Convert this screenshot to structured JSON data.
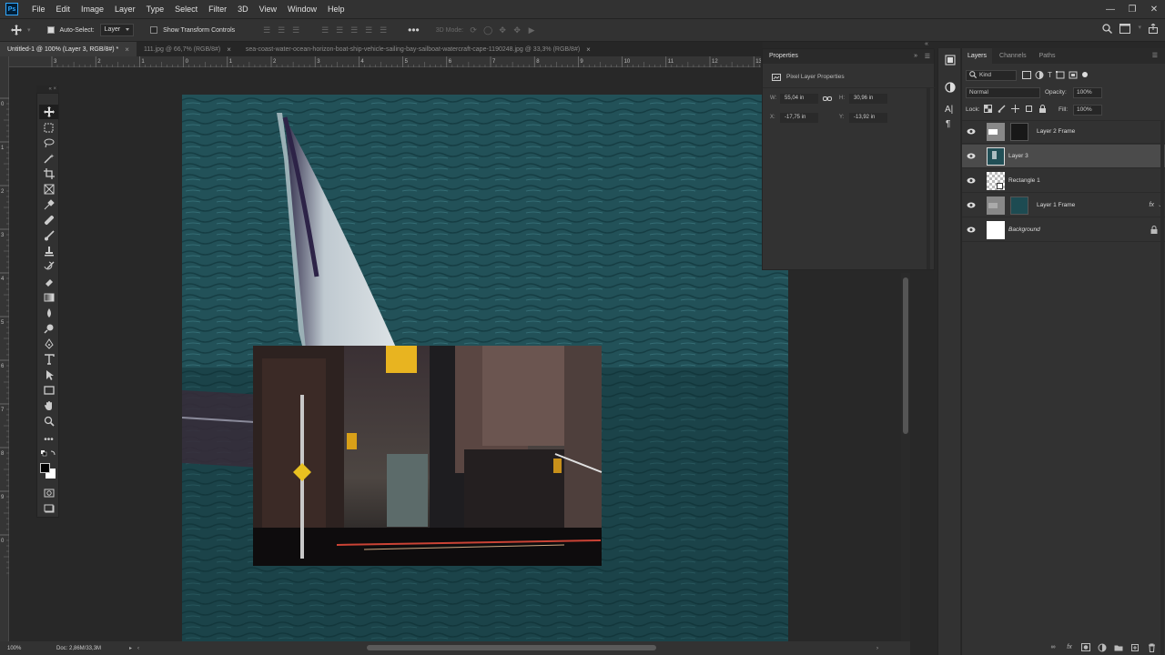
{
  "app": {
    "menu": [
      "File",
      "Edit",
      "Image",
      "Layer",
      "Type",
      "Select",
      "Filter",
      "3D",
      "View",
      "Window",
      "Help"
    ],
    "window_controls": [
      "minimize-icon",
      "restore-icon",
      "close-icon"
    ]
  },
  "options_bar": {
    "auto_select_label": "Auto-Select:",
    "auto_select_checked": true,
    "auto_select_target": "Layer",
    "show_transform_label": "Show Transform Controls",
    "show_transform_checked": false,
    "three_d_mode_label": "3D Mode:"
  },
  "tabs": [
    {
      "label": "Untitled-1 @ 100% (Layer 3, RGB/8#) *",
      "active": true
    },
    {
      "label": "111.jpg @ 66,7% (RGB/8#)",
      "active": false
    },
    {
      "label": "sea-coast-water-ocean-horizon-boat-ship-vehicle-sailing-bay-sailboat-watercraft-cape-1190248.jpg @ 33,3% (RGB/8#)",
      "active": false
    }
  ],
  "rulers": {
    "top": [
      "3",
      "2",
      "1",
      "0",
      "1",
      "2",
      "3",
      "4",
      "5",
      "6",
      "7",
      "8",
      "9",
      "10",
      "11",
      "12",
      "13"
    ],
    "left": [
      "0",
      "1",
      "2",
      "3",
      "4",
      "5",
      "6",
      "7",
      "8",
      "9",
      "0"
    ]
  },
  "status": {
    "zoom": "100%",
    "doc": "Doc: 2,86M/33,3M"
  },
  "properties": {
    "panel_title": "Properties",
    "subtitle": "Pixel Layer Properties",
    "w_label": "W:",
    "w_value": "55,04 in",
    "h_label": "H:",
    "h_value": "30,96 in",
    "x_label": "X:",
    "x_value": "-17,75 in",
    "y_label": "Y:",
    "y_value": "-13,92 in"
  },
  "layers_panel": {
    "tabs": [
      "Layers",
      "Channels",
      "Paths"
    ],
    "filter_kind": "Kind",
    "blend_mode": "Normal",
    "opacity_label": "Opacity:",
    "opacity_value": "100%",
    "lock_label": "Lock:",
    "fill_label": "Fill:",
    "fill_value": "100%",
    "layers": [
      {
        "name": "Layer 2 Frame",
        "visible": true,
        "selected": false
      },
      {
        "name": "Layer 3",
        "visible": true,
        "selected": true
      },
      {
        "name": "Rectangle 1",
        "visible": true,
        "selected": false
      },
      {
        "name": "Layer 1 Frame",
        "visible": true,
        "selected": false,
        "fx": "fx"
      },
      {
        "name": "Background",
        "visible": true,
        "selected": false,
        "locked": true
      }
    ]
  },
  "colors": {
    "accent_ps": "#31a8ff",
    "water": "#225158",
    "selected_layer": "#4b4b4b"
  }
}
